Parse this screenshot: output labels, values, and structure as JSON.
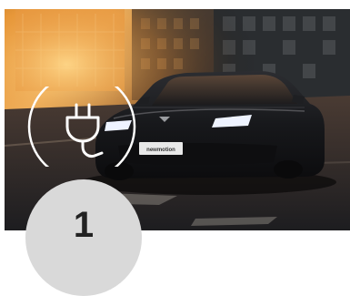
{
  "hero": {
    "icon": "ev-plug-icon",
    "plate_text": "newmotion",
    "colors": {
      "sunset": "#f0a23a",
      "road": "#2a2a2d",
      "car": "#1c1d20",
      "badge": "#d9d9d9",
      "icon_stroke": "#ffffff"
    }
  },
  "step": {
    "number": "1"
  }
}
